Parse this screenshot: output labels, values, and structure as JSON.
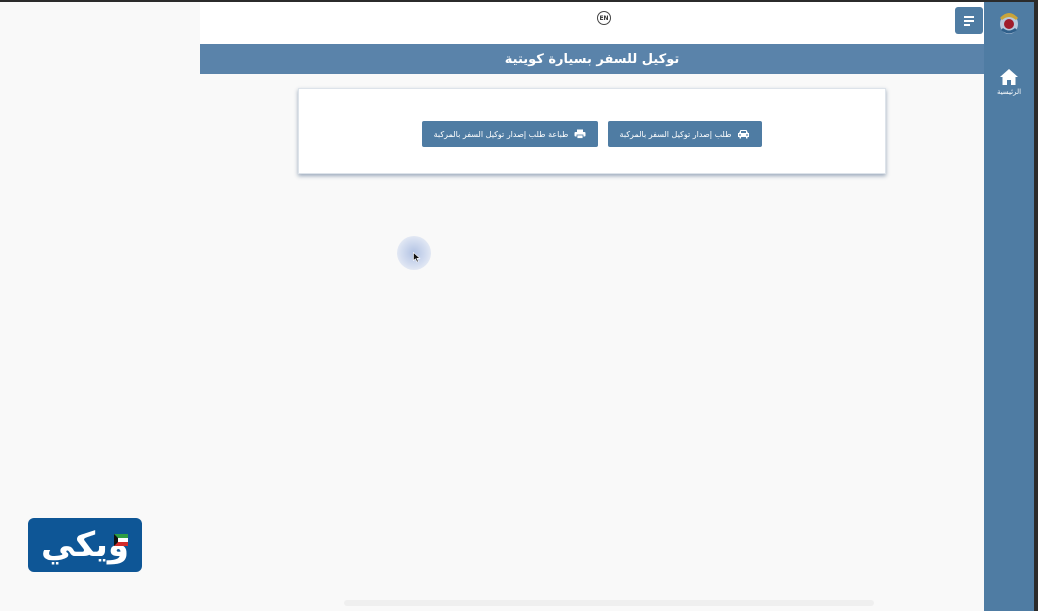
{
  "header": {
    "lang_button": "EN",
    "page_title": "توكيل للسفر بسيارة كويتية"
  },
  "sidebar": {
    "home_label": "الرئيسية"
  },
  "actions": {
    "request_label": "طلب إصدار توكيل السفر بالمركبة",
    "print_label": "طباعة طلب إصدار توكيل السفر بالمركبة"
  },
  "watermark": {
    "text": "ويكي"
  },
  "icons": {
    "menu": "hamburger-icon",
    "home": "home-icon",
    "car": "car-icon",
    "printer": "printer-icon"
  },
  "colors": {
    "primary": "#4f7ca3",
    "title_bar": "#5a83aa",
    "watermark_bg": "#0e5696"
  }
}
